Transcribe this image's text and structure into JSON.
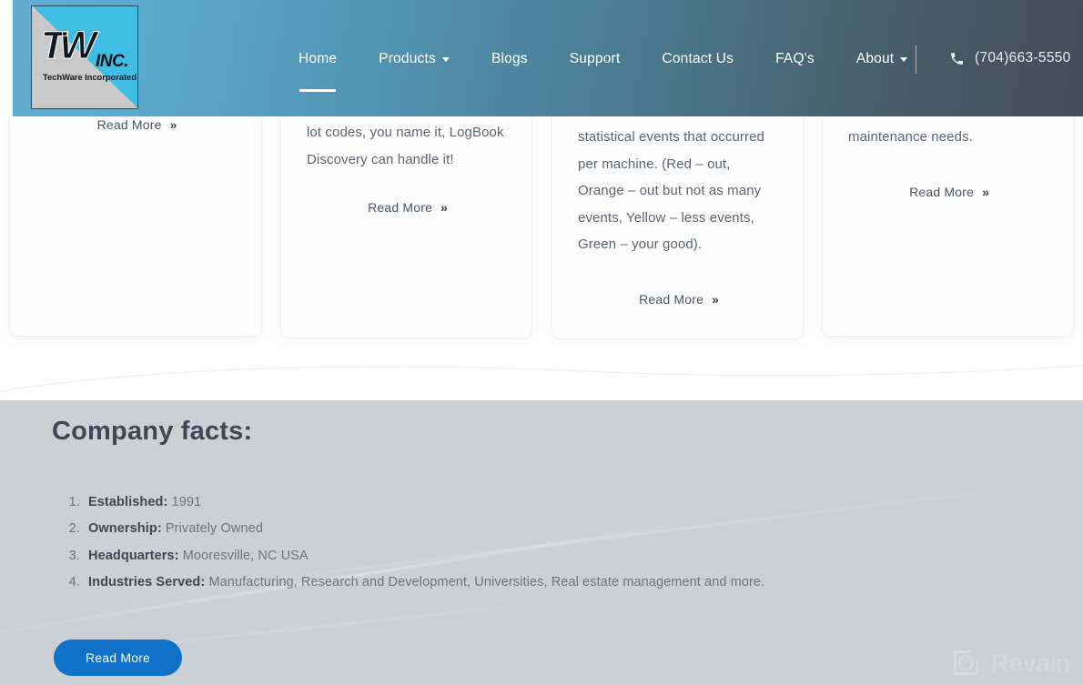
{
  "header": {
    "logo": {
      "monogram": "TW",
      "inc": "INC.",
      "subtitle": "TechWare Incorporated"
    },
    "nav": [
      {
        "label": "Home",
        "caret": false,
        "active": true
      },
      {
        "label": "Products",
        "caret": true,
        "active": false
      },
      {
        "label": "Blogs",
        "caret": false,
        "active": false
      },
      {
        "label": "Support",
        "caret": false,
        "active": false
      },
      {
        "label": "Contact Us",
        "caret": false,
        "active": false
      },
      {
        "label": "FAQ's",
        "caret": false,
        "active": false
      },
      {
        "label": "About",
        "caret": true,
        "active": false
      }
    ],
    "phone": "(704)663-5550",
    "phone_icon": "phone-icon",
    "gradient_start": "#61b0d2",
    "gradient_end": "#434d56"
  },
  "cards": [
    {
      "body": "",
      "read_more": "Read More",
      "chevron": "»"
    },
    {
      "body": "lot codes, you name it, LogBook Discovery can handle it!",
      "read_more": "Read More",
      "chevron": "»"
    },
    {
      "body": "statistical events that occurred per machine. (Red – out, Orange – out but not as many events, Yellow – less events, Green – your good).",
      "read_more": "Read More",
      "chevron": "»"
    },
    {
      "body": "maintenance needs.",
      "read_more": "Read More",
      "chevron": "»"
    }
  ],
  "facts": {
    "title": "Company facts:",
    "items": [
      {
        "label": "Established:",
        "value": "1991"
      },
      {
        "label": "Ownership:",
        "value": "Privately Owned"
      },
      {
        "label": "Headquarters:",
        "value": "Mooresville, NC USA"
      },
      {
        "label": "Industries Served:",
        "value": "Manufacturing, Research and Development, Universities, Real estate management and more."
      }
    ],
    "read_more_button": "Read More",
    "button_color": "#1071c8",
    "section_bg": "#cbd0d5"
  },
  "watermark": {
    "text": "Revain",
    "icon": "revain-logo-icon"
  }
}
